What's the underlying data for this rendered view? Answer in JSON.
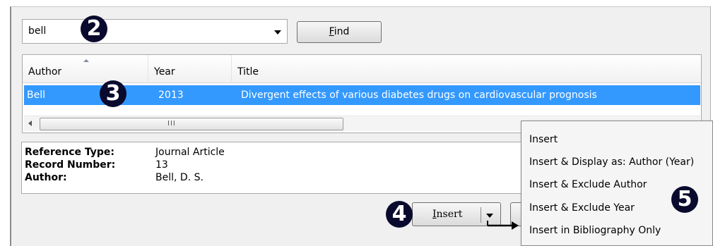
{
  "search": {
    "value": "bell",
    "find_label_prefix": "",
    "find_label_accel": "F",
    "find_label_rest": "ind"
  },
  "list": {
    "columns": [
      {
        "label": "Author"
      },
      {
        "label": "Year"
      },
      {
        "label": "Title"
      }
    ],
    "rows": [
      {
        "author": "Bell",
        "year": "2013",
        "title": "Divergent effects of various diabetes drugs on cardiovascular prognosis"
      }
    ],
    "scroll_grip": "III"
  },
  "details": [
    {
      "label": "Reference Type:",
      "value": "Journal Article"
    },
    {
      "label": "Record Number:",
      "value": "13"
    },
    {
      "label": "Author:",
      "value": "Bell, D. S."
    }
  ],
  "insert_button": {
    "accel": "I",
    "rest": "nsert"
  },
  "insert_menu": {
    "items": [
      "Insert",
      "Insert & Display as: Author (Year)",
      "Insert & Exclude Author",
      "Insert & Exclude Year",
      "Insert in Bibliography Only"
    ]
  },
  "callouts": {
    "c2": "2",
    "c3": "3",
    "c4": "4",
    "c5": "5"
  },
  "colors": {
    "selection": "#3399ff",
    "callout": "#0a0a2e"
  }
}
